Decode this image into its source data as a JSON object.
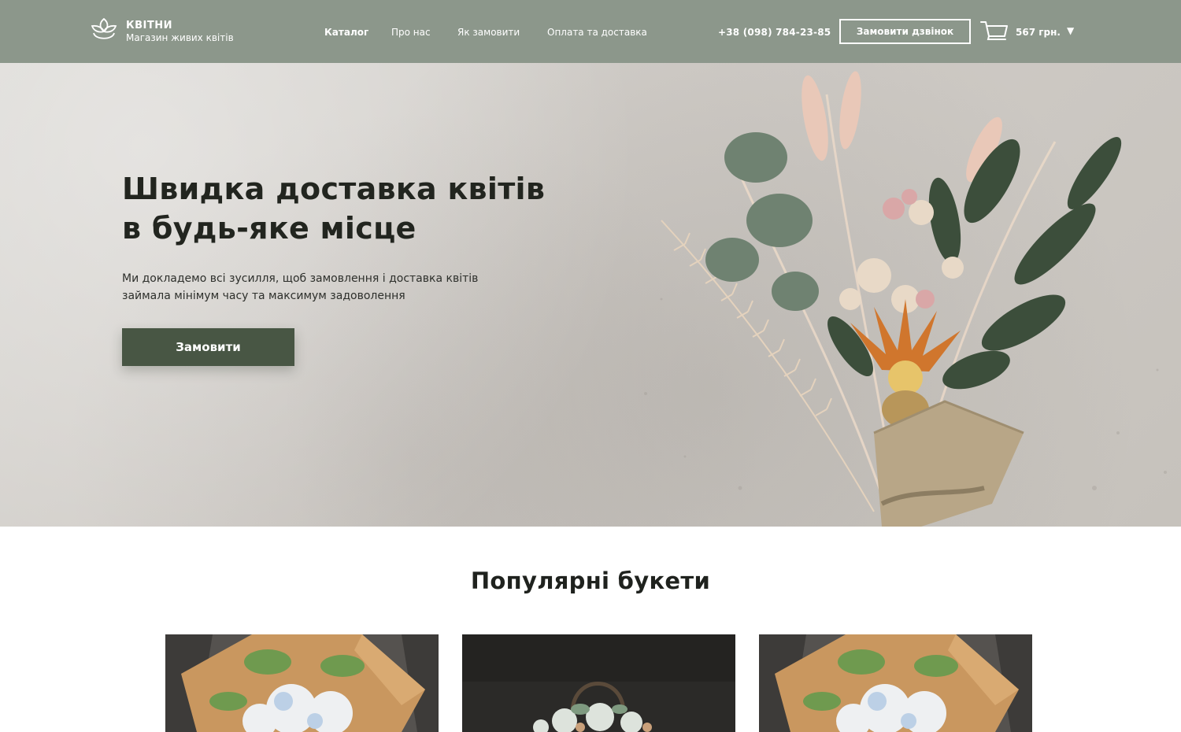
{
  "header": {
    "logo_title": "КВІТНИ",
    "logo_subtitle": "Магазин живих квітів",
    "nav": [
      {
        "label": "Каталог",
        "active": true
      },
      {
        "label": "Про нас",
        "active": false
      },
      {
        "label": "Як замовити",
        "active": false
      },
      {
        "label": "Оплата та доставка",
        "active": false
      }
    ],
    "phone": "+38 (098) 784-23-85",
    "call_button": "Замовити дзвінок",
    "cart": {
      "icon": "cart-icon",
      "total": "567 грн.",
      "caret": "▼"
    }
  },
  "hero": {
    "title_line1": "Швидка доставка квітів",
    "title_line2": "в будь-яке місце",
    "text_line1": "Ми докладемо всі зусилля, щоб замовлення і доставка квітів",
    "text_line2": "займала мінімум часу та максимум задоволення",
    "button": "Замовити"
  },
  "popular": {
    "title": "Популярні букети",
    "cards": [
      {
        "image": "bouquet-white-hydrangea-kraft"
      },
      {
        "image": "bouquet-basket-dark"
      },
      {
        "image": "bouquet-white-hydrangea-kraft"
      }
    ]
  },
  "colors": {
    "header_bg": "#8c978b",
    "accent_dark_green": "#485644",
    "hero_bg": "#d3d0cb",
    "text_dark": "#22251f"
  }
}
